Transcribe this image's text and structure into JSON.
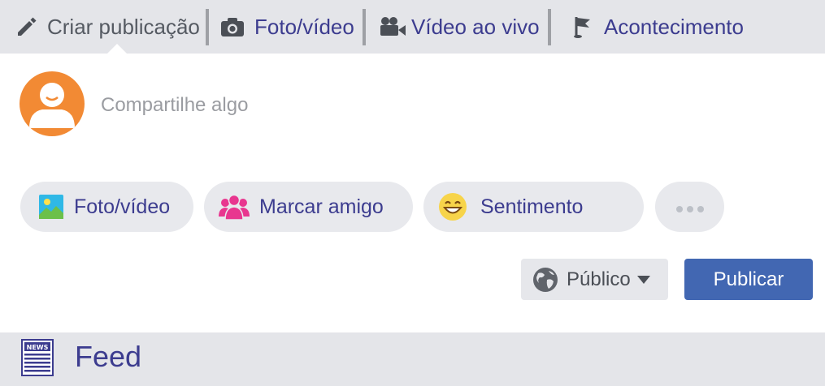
{
  "tabs": [
    {
      "label": "Criar publicação",
      "icon": "pencil-icon"
    },
    {
      "label": "Foto/vídeo",
      "icon": "camera-icon"
    },
    {
      "label": "Vídeo ao vivo",
      "icon": "video-camera-icon"
    },
    {
      "label": "Acontecimento",
      "icon": "flag-icon"
    }
  ],
  "composer": {
    "placeholder": "Compartilhe algo",
    "avatar_icon": "user-avatar-icon"
  },
  "actions": [
    {
      "label": "Foto/vídeo",
      "icon": "photo-icon"
    },
    {
      "label": "Marcar amigo",
      "icon": "friends-icon"
    },
    {
      "label": "Sentimento",
      "icon": "smiley-icon"
    },
    {
      "label": "",
      "icon": "more-icon"
    }
  ],
  "privacy": {
    "label": "Público",
    "icon": "globe-icon"
  },
  "publish_label": "Publicar",
  "feed": {
    "label": "Feed",
    "icon": "news-icon",
    "icon_text": "NEWS"
  },
  "colors": {
    "accent": "#4267b2",
    "link_text": "#3c3c8f",
    "avatar": "#f28a34",
    "friends": "#e8368f",
    "smiley": "#f7d44a"
  }
}
